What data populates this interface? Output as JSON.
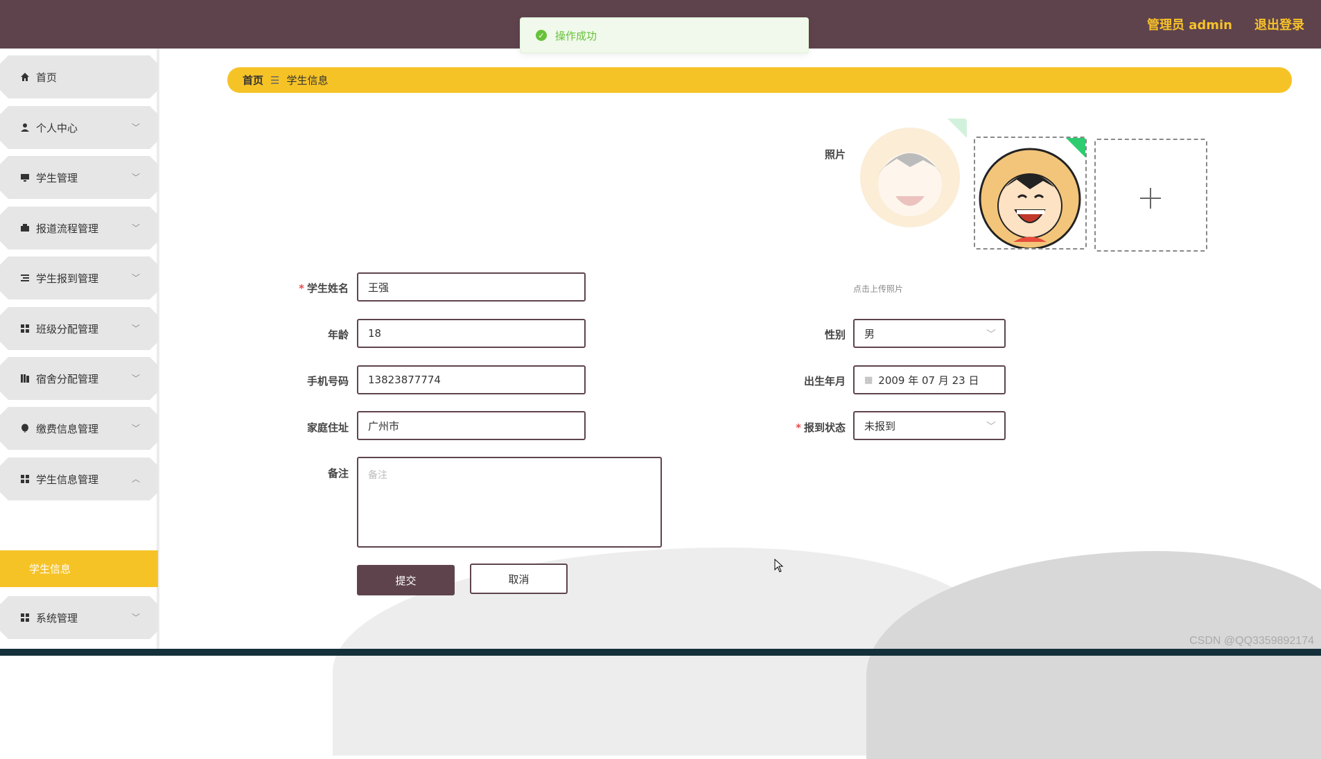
{
  "header": {
    "admin_label": "管理员 admin",
    "logout_label": "退出登录"
  },
  "toast": {
    "message": "操作成功"
  },
  "sidebar": {
    "items": [
      {
        "label": "首页"
      },
      {
        "label": "个人中心"
      },
      {
        "label": "学生管理"
      },
      {
        "label": "报道流程管理"
      },
      {
        "label": "学生报到管理"
      },
      {
        "label": "班级分配管理"
      },
      {
        "label": "宿舍分配管理"
      },
      {
        "label": "缴费信息管理"
      },
      {
        "label": "学生信息管理"
      },
      {
        "label": "系统管理"
      }
    ],
    "active_sub": "学生信息"
  },
  "breadcrumb": {
    "home": "首页",
    "sep": "☰",
    "current": "学生信息"
  },
  "form": {
    "photo_label": "照片",
    "photo_hint": "点击上传照片",
    "name_label": "学生姓名",
    "name_value": "王强",
    "age_label": "年龄",
    "age_value": "18",
    "phone_label": "手机号码",
    "phone_value": "13823877774",
    "address_label": "家庭住址",
    "address_value": "广州市",
    "remark_label": "备注",
    "remark_placeholder": "备注",
    "gender_label": "性别",
    "gender_value": "男",
    "birth_label": "出生年月",
    "birth_value": "2009 年 07 月 23 日",
    "status_label": "报到状态",
    "status_value": "未报到",
    "submit_label": "提交",
    "cancel_label": "取消"
  },
  "watermark": "CSDN @QQ3359892174",
  "colors": {
    "header_bg": "#5e434d",
    "accent": "#f6c327",
    "success": "#67c23a"
  }
}
